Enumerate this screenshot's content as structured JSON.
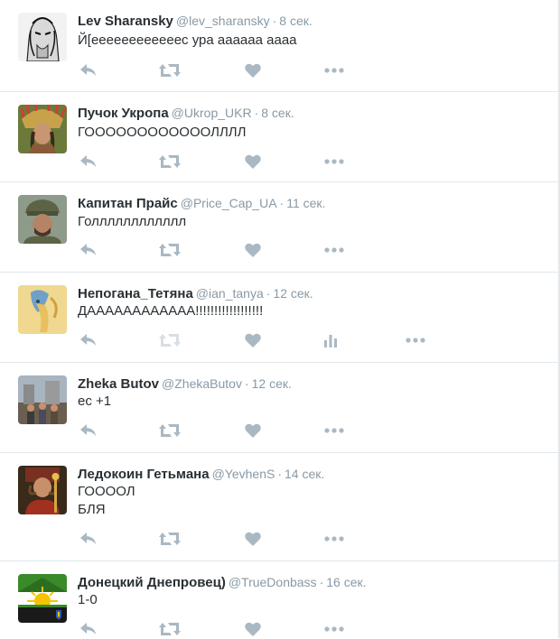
{
  "tweets": [
    {
      "name": "Lev Sharansky",
      "handle": "@lev_sharansky",
      "dot": "·",
      "time": "8 сек.",
      "lines": [
        "Й[еееееееееееес ура аааааа аааа"
      ]
    },
    {
      "name": "Пучок Укропа",
      "handle": "@Ukrop_UKR",
      "dot": "·",
      "time": "8 сек.",
      "lines": [
        "ГООООООООООООЛЛЛЛ"
      ]
    },
    {
      "name": "Капитан Прайс",
      "handle": "@Price_Cap_UA",
      "dot": "·",
      "time": "11 сек.",
      "lines": [
        "Голллллллллллл"
      ]
    },
    {
      "name": "Непогана_Тетяна",
      "handle": "@ian_tanya",
      "dot": "·",
      "time": "12 сек.",
      "lines": [
        "ДАААААААААААА!!!!!!!!!!!!!!!!!!"
      ]
    },
    {
      "name": "Zheka Butov",
      "handle": "@ZhekaButov",
      "dot": "·",
      "time": "12 сек.",
      "lines": [
        "ес +1"
      ]
    },
    {
      "name": "Ледокоин Гетьмана",
      "handle": "@YevhenS",
      "dot": "·",
      "time": "14 сек.",
      "lines": [
        "ГООООЛ",
        "БЛЯ"
      ]
    },
    {
      "name": "Донецкий Днепровец)",
      "handle": "@TrueDonbass",
      "dot": "·",
      "time": "16 сек.",
      "lines": [
        "1-0"
      ]
    }
  ],
  "actions": {
    "icons": [
      "reply-icon",
      "retweet-icon",
      "like-icon",
      "analytics-icon",
      "more-icon"
    ],
    "color": "#aab8c2"
  }
}
